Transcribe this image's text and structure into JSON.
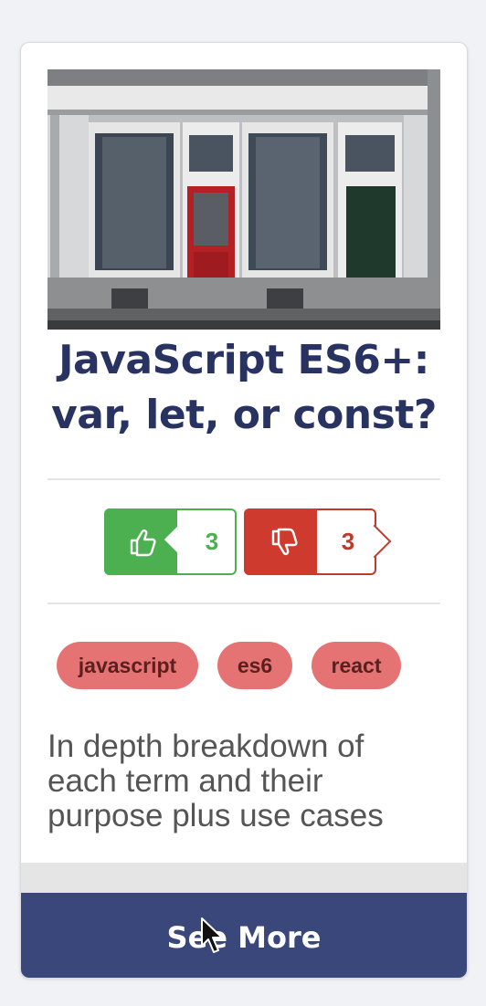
{
  "card": {
    "image": {
      "alt": "storefront-doors-photo"
    },
    "title": "JavaScript ES6+:\nvar, let, or const?",
    "votes": {
      "like_icon": "thumbs-up-icon",
      "like_count": "3",
      "dislike_icon": "thumbs-down-icon",
      "dislike_count": "3",
      "like_color": "#4caf50",
      "dislike_color": "#c0392b"
    },
    "tags": [
      "javascript",
      "es6",
      "react"
    ],
    "tag_color": "#e57373",
    "description": "In depth breakdown of each term and their purpose plus use cases",
    "see_more_label": "See More",
    "see_more_color": "#39477b",
    "title_color": "#283361"
  }
}
